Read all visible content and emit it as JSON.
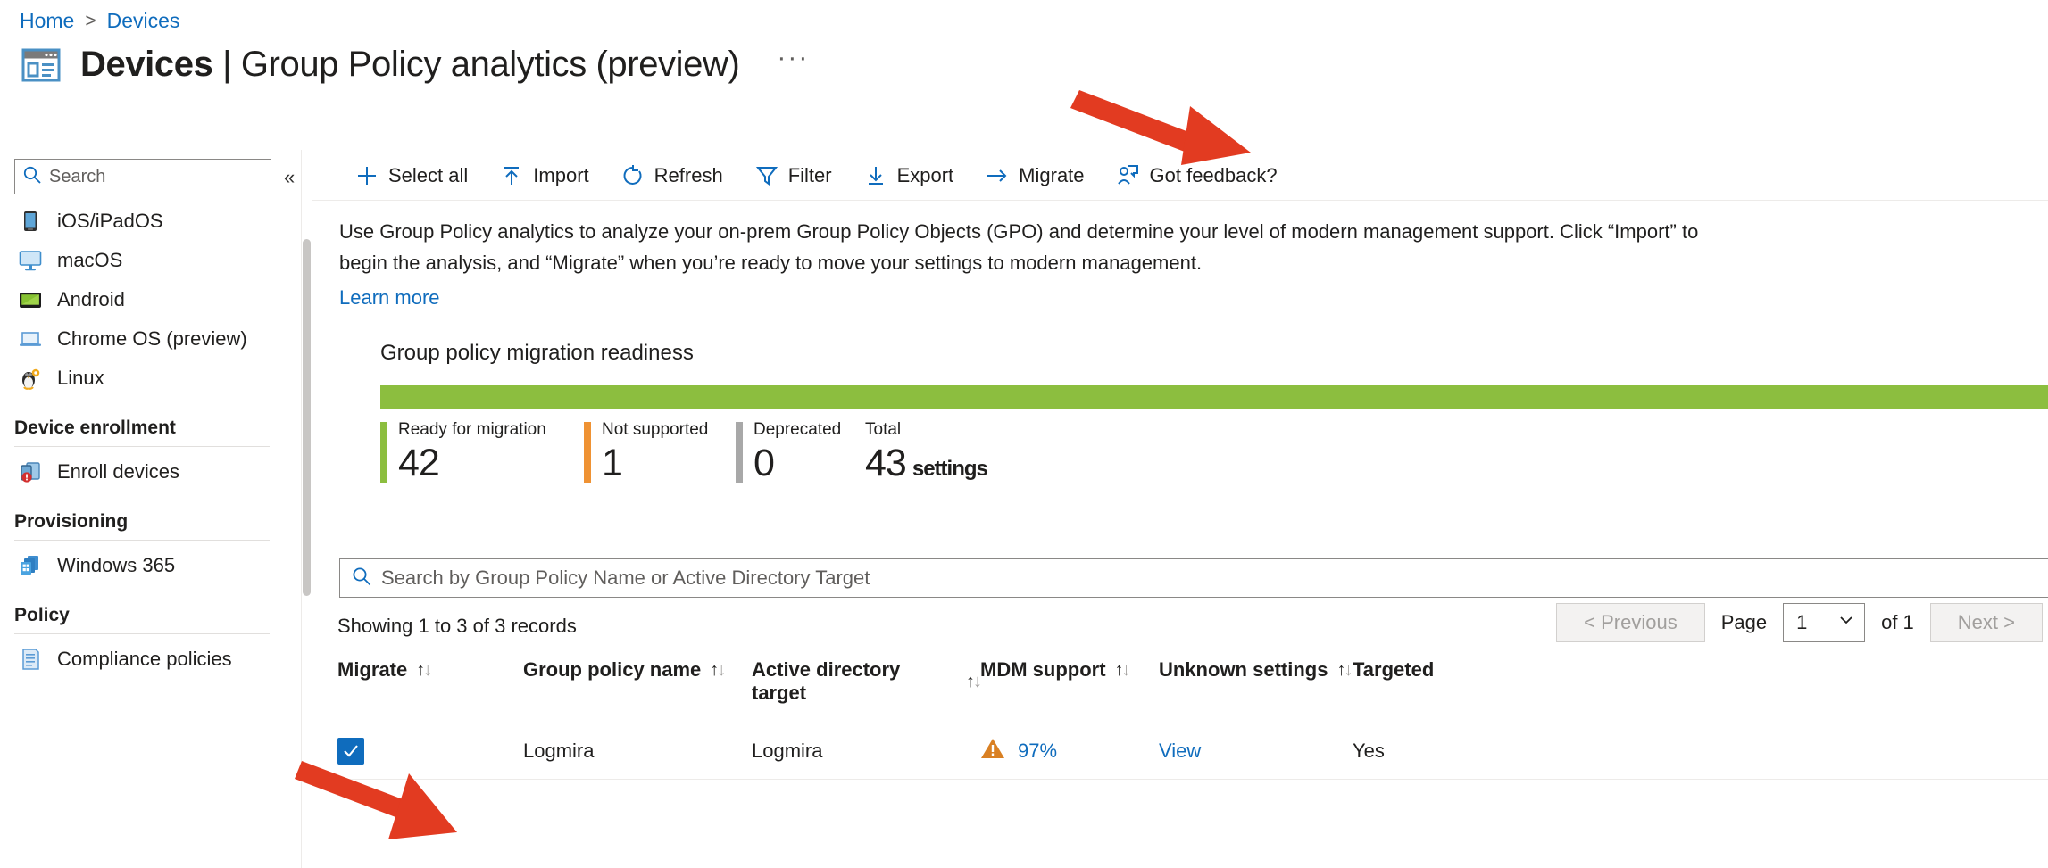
{
  "breadcrumb": {
    "home": "Home",
    "separator": ">",
    "current": "Devices"
  },
  "header": {
    "title_bold": "Devices",
    "title_sep": "|",
    "title_rest": "Group Policy analytics (preview)",
    "more_label": "···",
    "icon": "devices-blade-icon"
  },
  "sidebar": {
    "search": {
      "placeholder": "Search",
      "value": "",
      "icon": "search-icon"
    },
    "collapse_icon": "«",
    "items": [
      {
        "label": "iOS/iPadOS",
        "icon": "ios-device-icon"
      },
      {
        "label": "macOS",
        "icon": "macos-monitor-icon"
      },
      {
        "label": "Android",
        "icon": "android-device-icon"
      },
      {
        "label": "Chrome OS (preview)",
        "icon": "chromeos-laptop-icon"
      },
      {
        "label": "Linux",
        "icon": "linux-penguin-icon"
      }
    ],
    "groups": [
      {
        "title": "Device enrollment",
        "items": [
          {
            "label": "Enroll devices",
            "icon": "enroll-devices-icon"
          }
        ]
      },
      {
        "title": "Provisioning",
        "items": [
          {
            "label": "Windows 365",
            "icon": "windows365-icon"
          }
        ]
      },
      {
        "title": "Policy",
        "items": [
          {
            "label": "Compliance policies",
            "icon": "compliance-policies-icon"
          }
        ]
      }
    ]
  },
  "toolbar": {
    "items": [
      {
        "label": "Select all",
        "icon": "plus-icon"
      },
      {
        "label": "Import",
        "icon": "upload-arrow-icon"
      },
      {
        "label": "Refresh",
        "icon": "refresh-circle-icon"
      },
      {
        "label": "Filter",
        "icon": "funnel-icon"
      },
      {
        "label": "Export",
        "icon": "download-arrow-icon"
      },
      {
        "label": "Migrate",
        "icon": "right-arrow-icon"
      },
      {
        "label": "Got feedback?",
        "icon": "feedback-person-icon"
      }
    ]
  },
  "description": {
    "line1": "Use Group Policy analytics to analyze your on-prem Group Policy Objects (GPO) and determine your level of modern management support. Click “Import” to",
    "line2": "begin the analysis, and “Migrate” when you’re ready to move your settings to modern management.",
    "learn_more": "Learn more"
  },
  "readiness": {
    "title": "Group policy migration readiness",
    "stats": [
      {
        "label": "Ready for migration",
        "value": "42",
        "color": "#8cbe3f"
      },
      {
        "label": "Not supported",
        "value": "1",
        "color": "#ef9233"
      },
      {
        "label": "Deprecated",
        "value": "0",
        "color": "#a8a8a8"
      },
      {
        "label": "Total",
        "value": "43",
        "unit": "settings",
        "color": "transparent"
      }
    ]
  },
  "chart_data": {
    "type": "bar",
    "title": "Group policy migration readiness",
    "categories": [
      "Ready for migration",
      "Not supported",
      "Deprecated"
    ],
    "values": [
      42,
      1,
      0
    ],
    "total": 43,
    "unit": "settings",
    "colors": [
      "#8cbe3f",
      "#ef9233",
      "#a8a8a8"
    ],
    "orientation": "stacked-horizontal",
    "xlabel": "",
    "ylabel": "",
    "legend": "inline-below-bar",
    "grid": false
  },
  "table_search": {
    "placeholder": "Search by Group Policy Name or Active Directory Target",
    "value": "",
    "icon": "search-icon"
  },
  "records_text": "Showing 1 to 3 of 3 records",
  "pagination": {
    "previous": "< Previous",
    "page_label": "Page",
    "page_value": "1",
    "of_label": "of 1",
    "next": "Next >"
  },
  "table": {
    "columns": [
      {
        "label": "Migrate",
        "sortable": true
      },
      {
        "label": "Group policy name",
        "sortable": true
      },
      {
        "label": "Active directory target",
        "sortable": true
      },
      {
        "label": "MDM support",
        "sortable": true
      },
      {
        "label": "Unknown settings",
        "sortable": true
      },
      {
        "label": "Targeted",
        "sortable": false
      }
    ],
    "rows": [
      {
        "migrate_checked": true,
        "group_policy_name": "Logmira",
        "active_directory_target": "Logmira",
        "mdm_support": "97%",
        "mdm_support_status": "warning",
        "unknown_settings": "View",
        "targeted": "Yes"
      }
    ]
  },
  "colors": {
    "accent": "#0f6cbd",
    "green": "#8cbe3f",
    "orange": "#ef9233",
    "gray": "#a8a8a8",
    "annotation_red": "#e23b21"
  },
  "annotations": [
    {
      "name": "arrow-to-migrate",
      "target": "Migrate"
    },
    {
      "name": "arrow-to-migrate-checkbox",
      "target": "Migrate checkbox"
    }
  ]
}
